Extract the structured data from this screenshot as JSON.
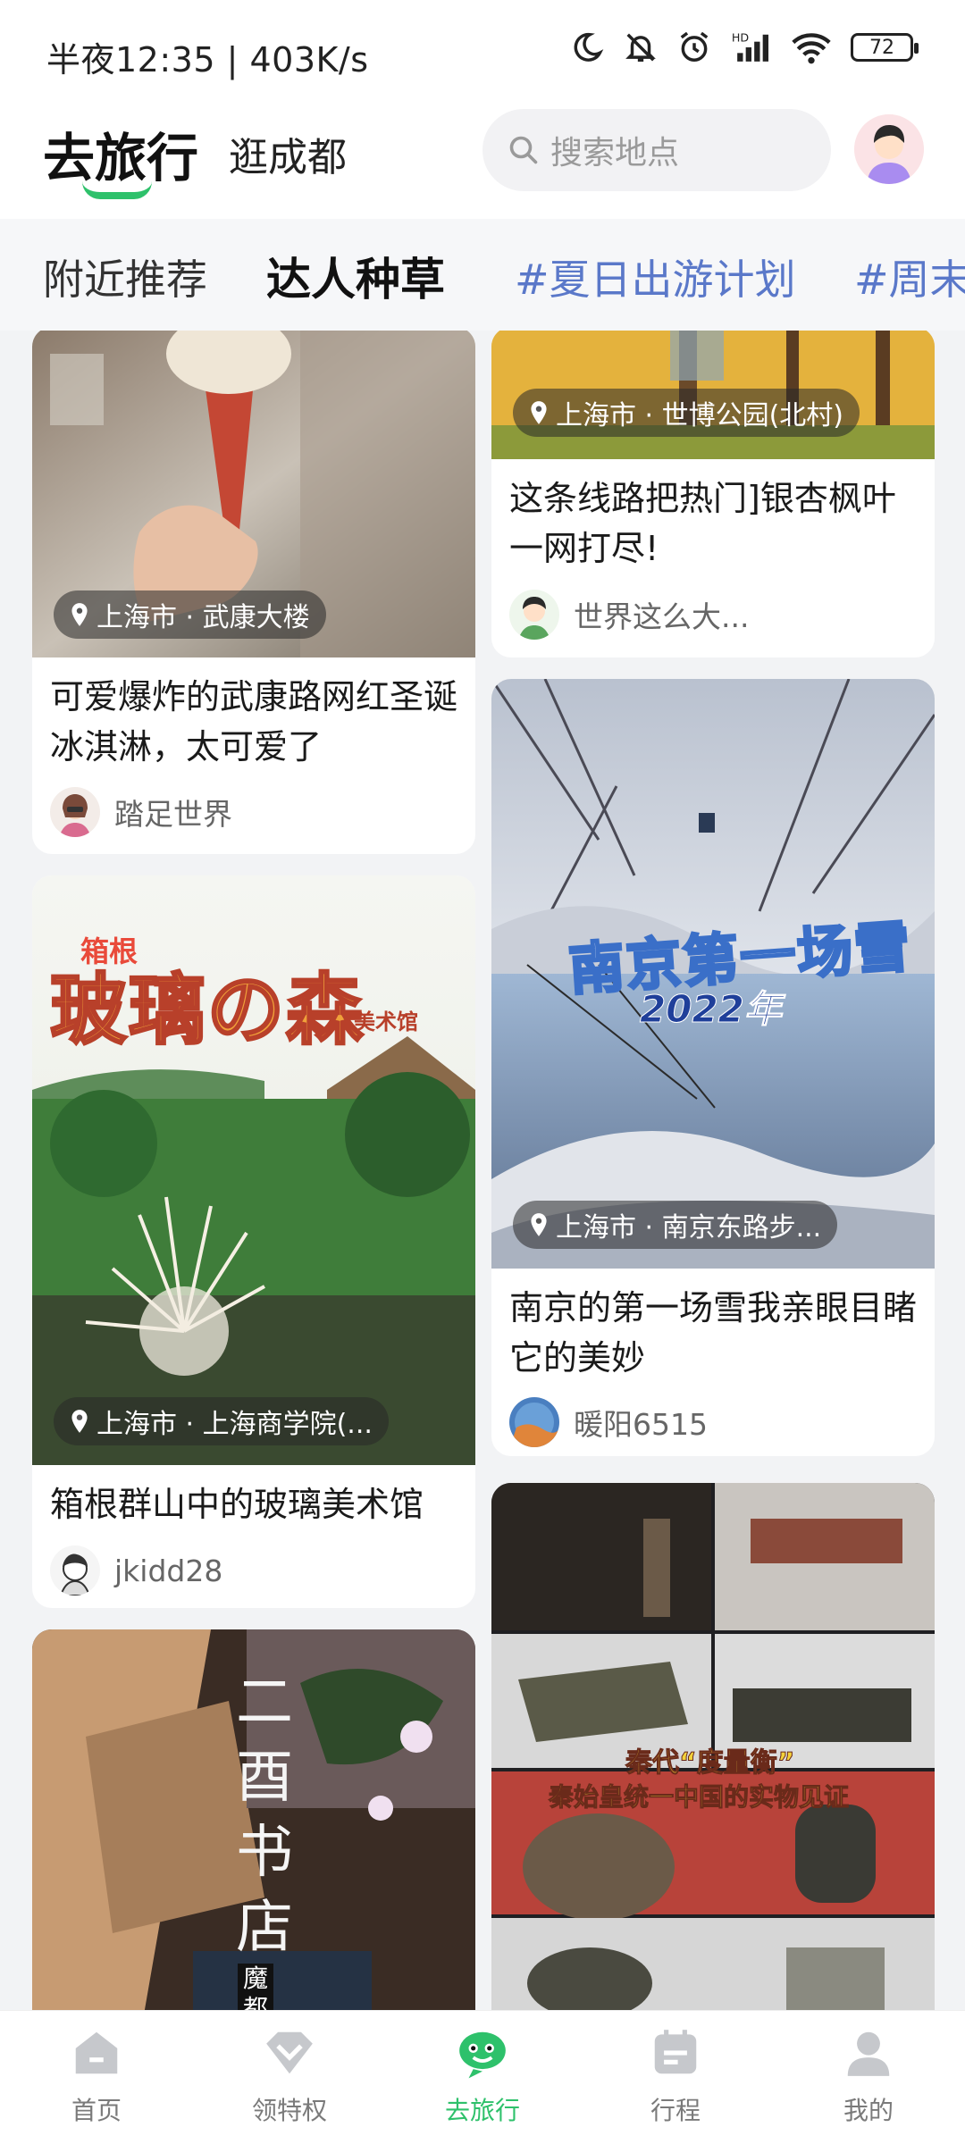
{
  "status_bar": {
    "time_speed": "半夜12:35 | 403K/s",
    "battery": "72"
  },
  "header": {
    "title": "去旅行",
    "city": "逛成都",
    "search_placeholder": "搜索地点"
  },
  "tabs": [
    "附近推荐",
    "达人种草",
    "#夏日出游计划",
    "#周末"
  ],
  "cards": [
    {
      "location": "上海市 · 武康大楼",
      "title": "可爱爆炸的武康路网红圣诞冰淇淋，太可爱了",
      "author": "踏足世界"
    },
    {
      "location": "上海市 · 世博公园(北村)",
      "title": "这条线路把热门]银杏枫叶一网打尽!",
      "author": "世界这么大..."
    },
    {
      "location": "上海市 · 南京东路步...",
      "title": "南京的第一场雪我亲眼目睹它的美妙",
      "author": "暖阳6515",
      "overlay_title": "南京第一场雪",
      "overlay_year": "2022年"
    },
    {
      "location": "上海市 · 上海商学院(...",
      "title": "箱根群山中的玻璃美术馆",
      "author": "jkidd28",
      "overlay_small": "箱根",
      "overlay_title": "玻璃の森",
      "overlay_sub": "美术馆"
    },
    {
      "overlay_line1": "秦代“度量衡”",
      "overlay_line2": "秦始皇统一中国的实物见证"
    },
    {
      "overlay_title": "二酉书店",
      "overlay_sub": "魔都"
    }
  ],
  "bottom_nav": [
    {
      "label": "首页",
      "icon": "home-icon"
    },
    {
      "label": "领特权",
      "icon": "diamond-icon"
    },
    {
      "label": "去旅行",
      "icon": "travel-mascot-icon"
    },
    {
      "label": "行程",
      "icon": "calendar-icon"
    },
    {
      "label": "我的",
      "icon": "person-icon"
    }
  ],
  "colors": {
    "accent": "#2ec16b",
    "topic": "#5a78c9"
  }
}
